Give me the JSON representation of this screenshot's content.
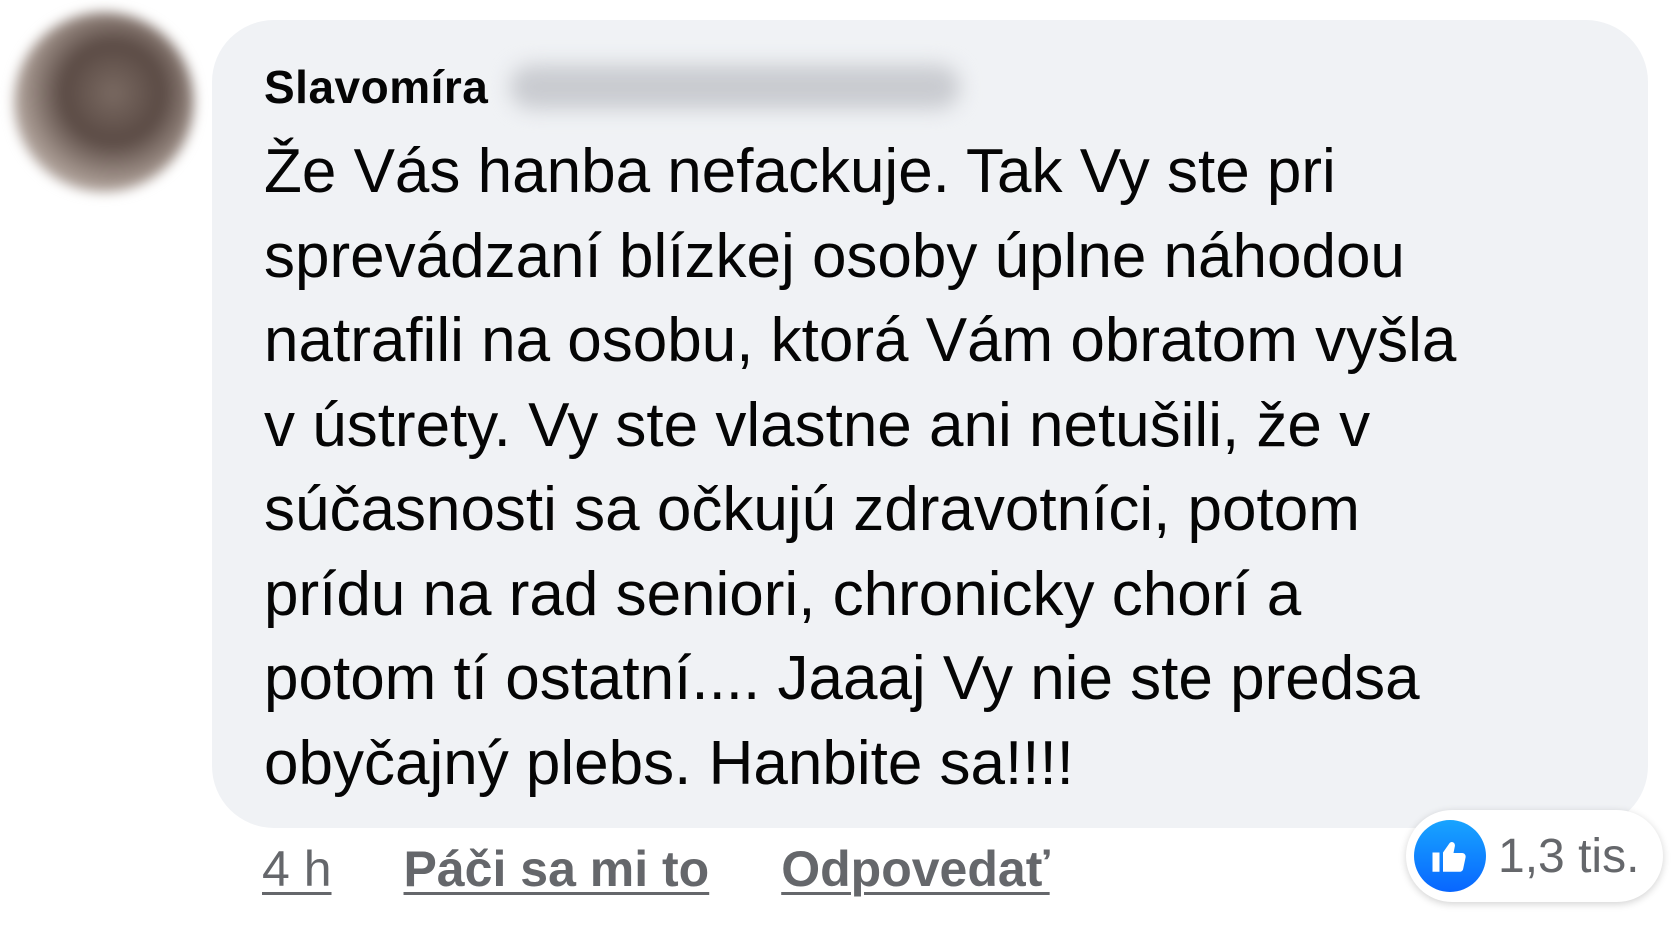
{
  "comment": {
    "author": "Slavomíra",
    "text": "Že Vás hanba nefackuje. Tak Vy ste pri\nsprevádzaní blízkej osoby úplne náhodou\nnatrafili na osobu, ktorá Vám obratom vyšla\nv ústrety. Vy ste vlastne ani netušili, že v\nsúčasnosti sa očkujú zdravotníci, potom\nprídu na rad seniori, chronicky chorí a\npotom tí ostatní.... Jaaaj Vy nie ste predsa\nobyčajný plebs. Hanbite sa!!!!",
    "time": "4 h",
    "like_label": "Páči sa mi to",
    "reply_label": "Odpovedať",
    "reaction_count": "1,3 tis.",
    "reaction_icon": "thumbs-up-icon",
    "colors": {
      "bubble": "#f0f2f5",
      "like_blue": "#0866ff",
      "meta_gray": "#65676b"
    }
  }
}
